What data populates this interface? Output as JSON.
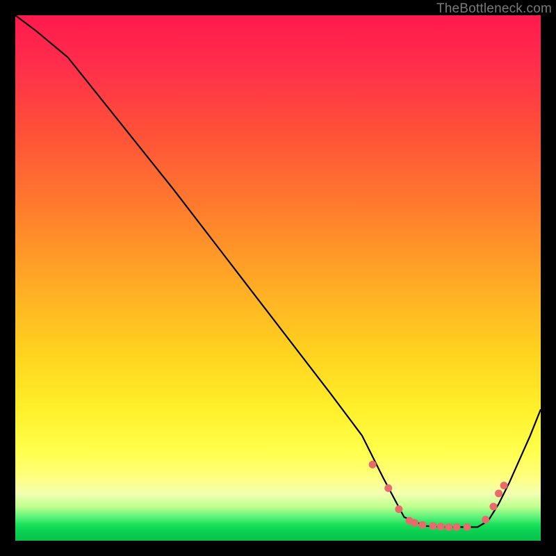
{
  "watermark": "TheBottleneck.com",
  "colors": {
    "frame": "#000000",
    "curve": "#000000",
    "marker": "#e96a6a",
    "gradient_top": "#ff1a4d",
    "gradient_bottom": "#08c24b"
  },
  "chart_data": {
    "type": "line",
    "title": "",
    "xlabel": "",
    "ylabel": "",
    "xlim": [
      0,
      100
    ],
    "ylim": [
      0,
      100
    ],
    "x": [
      0,
      4,
      10,
      20,
      30,
      40,
      50,
      60,
      66,
      70,
      74,
      78,
      82,
      86,
      88,
      90,
      92,
      94,
      98,
      100
    ],
    "y": [
      100,
      97,
      92,
      79.5,
      67,
      54,
      41,
      28,
      20,
      12,
      4.5,
      2.8,
      2.6,
      2.6,
      2.6,
      3.8,
      7,
      11,
      20,
      25
    ],
    "markers": {
      "x": [
        68,
        71,
        73,
        75,
        76,
        77.5,
        79.5,
        81,
        82.5,
        84,
        86,
        89.5,
        91,
        92,
        93
      ],
      "y": [
        14.5,
        10,
        6,
        3.8,
        3.4,
        3.0,
        2.8,
        2.7,
        2.6,
        2.6,
        2.6,
        4.0,
        6.5,
        9.0,
        10.5
      ]
    }
  }
}
